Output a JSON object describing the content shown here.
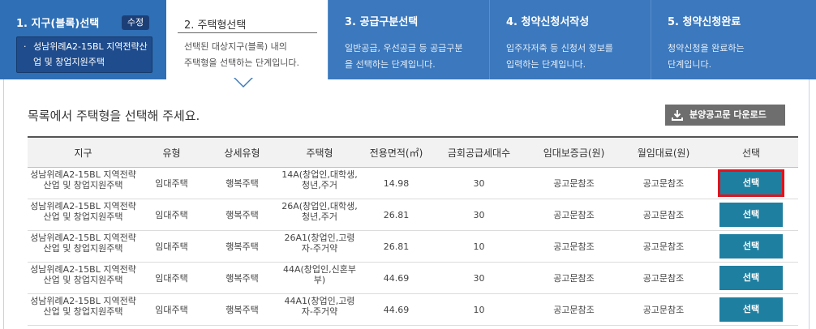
{
  "steps": [
    {
      "title": "1. 지구(블록)선택",
      "edit_label": "수정",
      "selected": "성남위례A2-15BL 지역전략산업 및 창업지원주택",
      "bullet": "·"
    },
    {
      "title": "2. 주택형선택",
      "desc_line1": "선택된 대상지구(블록) 내의",
      "desc_line2": "주택형을 선택하는 단계입니다."
    },
    {
      "title": "3. 공급구분선택",
      "desc_line1": "일반공급, 우선공급 등 공급구분",
      "desc_line2": "을 선택하는 단계입니다."
    },
    {
      "title": "4. 청약신청서작성",
      "desc_line1": "입주자저축 등 신청서 정보를",
      "desc_line2": "입력하는 단계입니다."
    },
    {
      "title": "5. 청약신청완료",
      "desc_line1": "청약신청을 완료하는",
      "desc_line2": "단계입니다."
    }
  ],
  "main": {
    "heading": "목록에서 주택형을 선택해 주세요.",
    "download_label": "분양공고문 다운로드"
  },
  "table": {
    "headers": [
      "지구",
      "유형",
      "상세유형",
      "주택형",
      "전용면적(㎡)",
      "금회공급세대수",
      "임대보증금(원)",
      "월임대료(원)",
      "선택"
    ],
    "rows": [
      {
        "district": "성남위례A2-15BL 지역전략산업 및 창업지원주택",
        "type": "임대주택",
        "subtype": "행복주택",
        "housing": "14A(창업인,대학생,청년,주거",
        "area": "14.98",
        "units": "30",
        "deposit": "공고문참조",
        "rent": "공고문참조",
        "select": "선택"
      },
      {
        "district": "성남위례A2-15BL 지역전략산업 및 창업지원주택",
        "type": "임대주택",
        "subtype": "행복주택",
        "housing": "26A(창업인,대학생,청년,주거",
        "area": "26.81",
        "units": "30",
        "deposit": "공고문참조",
        "rent": "공고문참조",
        "select": "선택"
      },
      {
        "district": "성남위례A2-15BL 지역전략산업 및 창업지원주택",
        "type": "임대주택",
        "subtype": "행복주택",
        "housing": "26A1(창업인,고령자-주거약",
        "area": "26.81",
        "units": "10",
        "deposit": "공고문참조",
        "rent": "공고문참조",
        "select": "선택"
      },
      {
        "district": "성남위례A2-15BL 지역전략산업 및 창업지원주택",
        "type": "임대주택",
        "subtype": "행복주택",
        "housing": "44A(창업인,신혼부부)",
        "area": "44.69",
        "units": "30",
        "deposit": "공고문참조",
        "rent": "공고문참조",
        "select": "선택"
      },
      {
        "district": "성남위례A2-15BL 지역전략산업 및 창업지원주택",
        "type": "임대주택",
        "subtype": "행복주택",
        "housing": "44A1(창업인,고령자-주거약",
        "area": "44.69",
        "units": "10",
        "deposit": "공고문참조",
        "rent": "공고문참조",
        "select": "선택"
      }
    ]
  },
  "colors": {
    "banner": "#3b78bd",
    "active_step": "#ffffff",
    "select_button": "#1f7fa0",
    "highlight": "#e3121c"
  }
}
